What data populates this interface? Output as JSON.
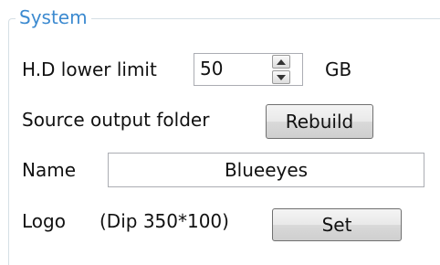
{
  "system": {
    "legend": "System",
    "hd_lower_limit": {
      "label": "H.D lower limit",
      "value": "50",
      "unit": "GB"
    },
    "source_output_folder": {
      "label": "Source output folder",
      "button_label": "Rebuild"
    },
    "name": {
      "label": "Name",
      "value": "Blueeyes"
    },
    "logo": {
      "label": "Logo",
      "hint": "(Dip 350*100)",
      "button_label": "Set"
    }
  },
  "icons": {
    "spin_up": "triangle-up-icon",
    "spin_down": "triangle-down-icon"
  },
  "colors": {
    "legend_text": "#3c8ad0",
    "group_border": "#d5dfe5",
    "field_border": "#abadb3",
    "button_border": "#707070"
  }
}
